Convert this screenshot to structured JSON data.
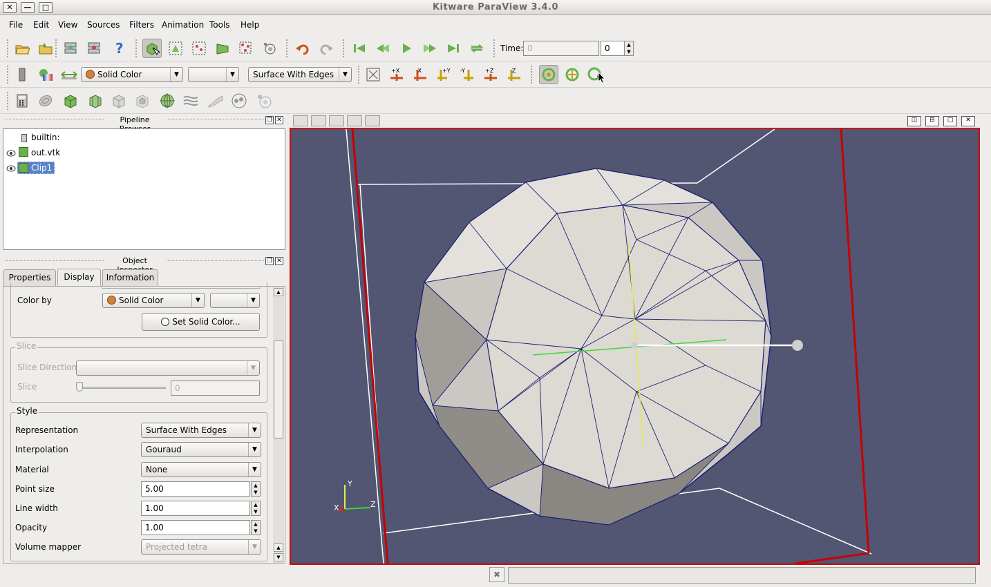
{
  "window": {
    "title": "Kitware ParaView 3.4.0",
    "close": "✕",
    "minimize": "—",
    "maximize": "□"
  },
  "menu": [
    "File",
    "Edit",
    "View",
    "Sources",
    "Filters",
    "Animation",
    "Tools",
    "Help"
  ],
  "toolbar": {
    "time_label": "Time:",
    "time_value": "0",
    "time_index": "0",
    "color_combo": "Solid Color",
    "representation_combo": "Surface With Edges"
  },
  "pipeline": {
    "title": "Pipeline Browser",
    "items": [
      "builtin:",
      "out.vtk",
      "Clip1"
    ]
  },
  "inspector": {
    "title": "Object Inspector",
    "tabs": [
      "Properties",
      "Display",
      "Information"
    ],
    "color_by_label": "Color by",
    "color_by_value": "Solid Color",
    "set_solid_color": "Set Solid Color...",
    "slice_group": "Slice",
    "slice_direction_label": "Slice Direction",
    "slice_label": "Slice",
    "slice_value": "0",
    "style_group": "Style",
    "representation_label": "Representation",
    "representation_value": "Surface With Edges",
    "interpolation_label": "Interpolation",
    "interpolation_value": "Gouraud",
    "material_label": "Material",
    "material_value": "None",
    "point_size_label": "Point size",
    "point_size_value": "5.00",
    "line_width_label": "Line width",
    "line_width_value": "1.00",
    "opacity_label": "Opacity",
    "opacity_value": "1.00",
    "volume_mapper_label": "Volume mapper",
    "volume_mapper_value": "Projected tetra"
  },
  "viewport": {
    "axis_x": "X",
    "axis_y": "Y",
    "axis_z": "Z",
    "background": "#525672",
    "border": "#d40000"
  },
  "statusbar": {
    "text": ""
  }
}
